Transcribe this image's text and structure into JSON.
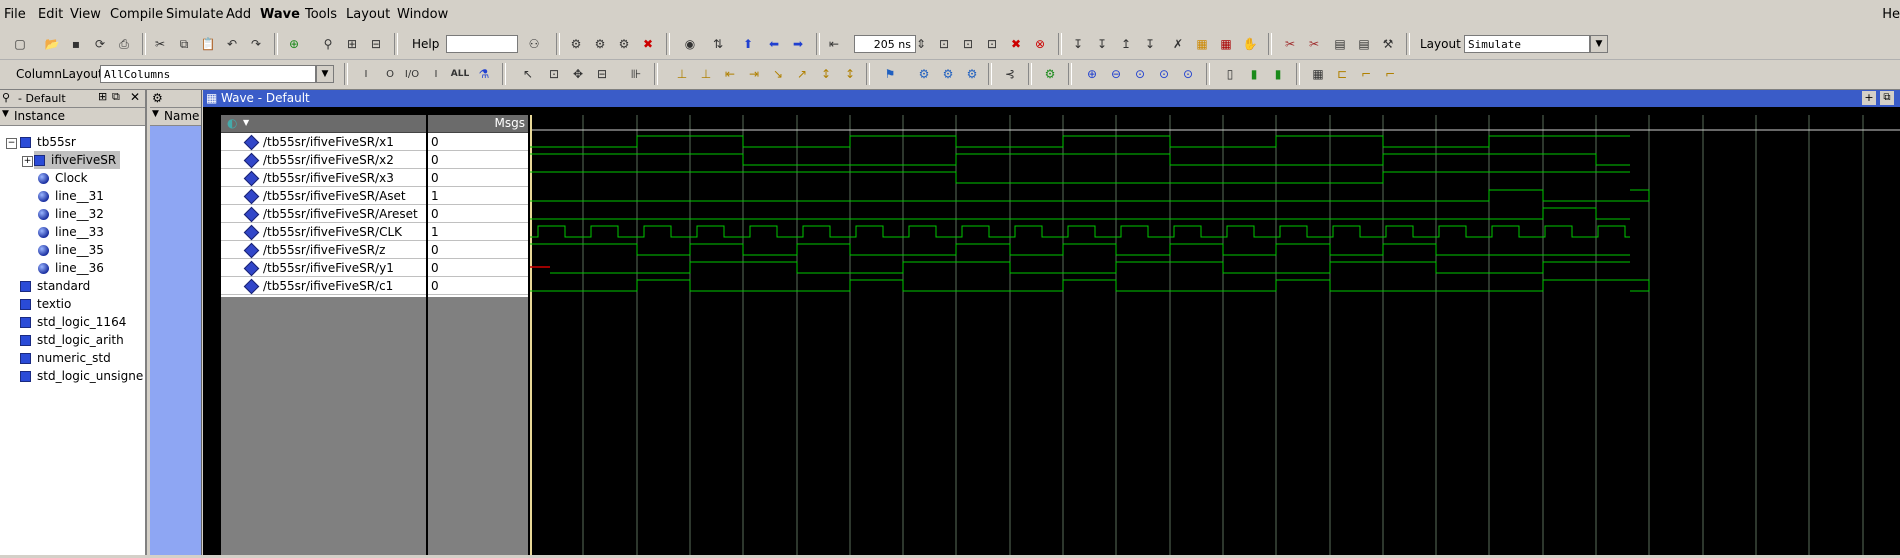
{
  "menu": {
    "items": [
      "File",
      "Edit",
      "View",
      "Compile",
      "Simulate",
      "Add",
      "Wave",
      "Tools",
      "Layout",
      "Window"
    ],
    "truncated_right": "He"
  },
  "toolbar": {
    "help_label": "Help",
    "help_value": "",
    "time_value": "205 ns",
    "layout_label": "Layout",
    "layout_value": "Simulate",
    "column_layout_label": "ColumnLayout",
    "column_layout_value": "AllColumns"
  },
  "instance_panel": {
    "title": "- Default",
    "header": "Instance",
    "tree": [
      {
        "label": "tb55sr",
        "icon": "square",
        "level": 0,
        "expanded": true
      },
      {
        "label": "ifiveFiveSR",
        "icon": "square",
        "level": 1,
        "selected": true,
        "expander": "+"
      },
      {
        "label": "Clock",
        "icon": "ball",
        "level": 2
      },
      {
        "label": "line__31",
        "icon": "ball",
        "level": 2
      },
      {
        "label": "line__32",
        "icon": "ball",
        "level": 2
      },
      {
        "label": "line__33",
        "icon": "ball",
        "level": 2
      },
      {
        "label": "line__35",
        "icon": "ball",
        "level": 2
      },
      {
        "label": "line__36",
        "icon": "ball",
        "level": 2
      },
      {
        "label": "standard",
        "icon": "square",
        "level": 0
      },
      {
        "label": "textio",
        "icon": "square",
        "level": 0
      },
      {
        "label": "std_logic_1164",
        "icon": "square",
        "level": 0
      },
      {
        "label": "std_logic_arith",
        "icon": "square",
        "level": 0
      },
      {
        "label": "numeric_std",
        "icon": "square",
        "level": 0
      },
      {
        "label": "std_logic_unsigned",
        "icon": "square",
        "level": 0
      }
    ]
  },
  "objects_panel": {
    "header": "Name"
  },
  "wave": {
    "title": "Wave - Default",
    "msgs_label": "Msgs",
    "signals": [
      {
        "name": "/tb55sr/ifiveFiveSR/x1",
        "value": "0"
      },
      {
        "name": "/tb55sr/ifiveFiveSR/x2",
        "value": "0"
      },
      {
        "name": "/tb55sr/ifiveFiveSR/x3",
        "value": "0"
      },
      {
        "name": "/tb55sr/ifiveFiveSR/Aset",
        "value": "1"
      },
      {
        "name": "/tb55sr/ifiveFiveSR/Areset",
        "value": "0"
      },
      {
        "name": "/tb55sr/ifiveFiveSR/CLK",
        "value": "1"
      },
      {
        "name": "/tb55sr/ifiveFiveSR/z",
        "value": "0"
      },
      {
        "name": "/tb55sr/ifiveFiveSR/y1",
        "value": "0"
      },
      {
        "name": "/tb55sr/ifiveFiveSR/c1",
        "value": "0"
      }
    ],
    "colors": {
      "trace": "#00c800",
      "grid": "#5a6e5a",
      "cursor": "#e8d898",
      "bg": "#000000",
      "undefined": "#d00000"
    }
  }
}
